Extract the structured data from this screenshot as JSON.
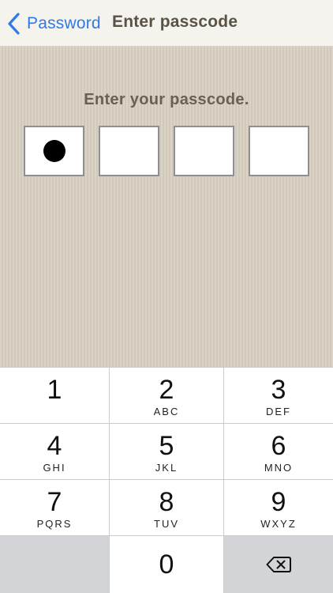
{
  "navbar": {
    "back_label": "Password",
    "title": "Enter passcode",
    "accent_color": "#2f7ae5",
    "back_icon": "chevron-left-icon"
  },
  "passcode": {
    "prompt": "Enter your passcode.",
    "length": 4,
    "entered_count": 1
  },
  "keypad": {
    "keys": [
      {
        "digit": "1",
        "letters": ""
      },
      {
        "digit": "2",
        "letters": "ABC"
      },
      {
        "digit": "3",
        "letters": "DEF"
      },
      {
        "digit": "4",
        "letters": "GHI"
      },
      {
        "digit": "5",
        "letters": "JKL"
      },
      {
        "digit": "6",
        "letters": "MNO"
      },
      {
        "digit": "7",
        "letters": "PQRS"
      },
      {
        "digit": "8",
        "letters": "TUV"
      },
      {
        "digit": "9",
        "letters": "WXYZ"
      }
    ],
    "zero": {
      "digit": "0"
    },
    "delete_icon": "backspace-icon"
  }
}
